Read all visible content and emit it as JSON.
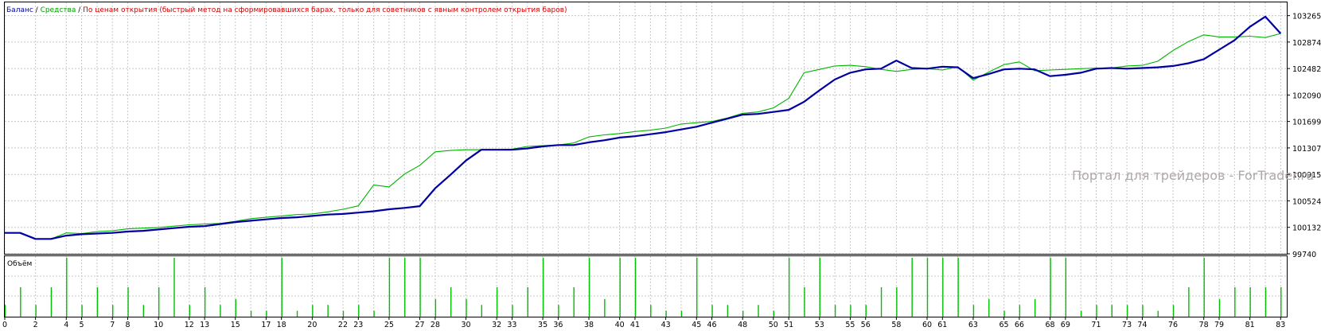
{
  "legend": {
    "balance": "Баланс",
    "sep1": " / ",
    "equity": "Средства",
    "sep2": " / ",
    "method": "По ценам открытия (быстрый метод на сформировавшихся барах, только для советников с явным контролем открытия баров)"
  },
  "watermark": "Портал для трейдеров - ForTrader.ru",
  "volume_label": "Объём",
  "colors": {
    "balance": "#0000a0",
    "equity": "#00b400",
    "volume": "#00c000",
    "grid": "#c8c8c8",
    "frame": "#000000"
  },
  "chart_data": [
    {
      "type": "line",
      "title": "",
      "ylim": [
        99740,
        103461
      ],
      "y_ticks": [
        103265,
        102874,
        102482,
        102090,
        101699,
        101307,
        100915,
        100524,
        100132,
        99740
      ],
      "x_ticks": [
        "0",
        "2",
        "4",
        "5",
        "7",
        "8",
        "10",
        "12",
        "13",
        "15",
        "17",
        "18",
        "20",
        "22",
        "23",
        "25",
        "27",
        "28",
        "30",
        "32",
        "33",
        "35",
        "36",
        "38",
        "40",
        "41",
        "43",
        "45",
        "46",
        "48",
        "50",
        "51",
        "53",
        "55",
        "56",
        "58",
        "60",
        "61",
        "63",
        "65",
        "66",
        "68",
        "69",
        "71",
        "73",
        "74",
        "76",
        "78",
        "79",
        "81",
        "83"
      ],
      "grid": true,
      "series": [
        {
          "name": "Баланс",
          "x": [
            0,
            1,
            2,
            3,
            4,
            5,
            6,
            7,
            8,
            9,
            10,
            11,
            12,
            13,
            14,
            15,
            16,
            17,
            18,
            19,
            20,
            21,
            22,
            23,
            24,
            25,
            26,
            27,
            28,
            29,
            30,
            31,
            32,
            33,
            34,
            35,
            36,
            37,
            38,
            39,
            40,
            41,
            42,
            43,
            44,
            45,
            46,
            47,
            48,
            49,
            50,
            51,
            52,
            53,
            54,
            55,
            56,
            57,
            58,
            59,
            60,
            61,
            62,
            63,
            64,
            65,
            66,
            67,
            68,
            69,
            70,
            71,
            72,
            73,
            74,
            75,
            76,
            77,
            78,
            79,
            80,
            81,
            82,
            83
          ],
          "values": [
            100050,
            100050,
            99960,
            99960,
            100010,
            100030,
            100040,
            100050,
            100070,
            100080,
            100100,
            100120,
            100140,
            100150,
            100180,
            100210,
            100230,
            100250,
            100270,
            100280,
            100300,
            100320,
            100330,
            100350,
            100370,
            100400,
            100420,
            100445,
            100710,
            100910,
            101120,
            101280,
            101280,
            101280,
            101300,
            101330,
            101350,
            101350,
            101390,
            101420,
            101460,
            101480,
            101510,
            101540,
            101580,
            101620,
            101680,
            101740,
            101800,
            101810,
            101840,
            101870,
            101990,
            102160,
            102320,
            102420,
            102470,
            102480,
            102600,
            102490,
            102480,
            102510,
            102500,
            102340,
            102400,
            102470,
            102480,
            102470,
            102370,
            102390,
            102420,
            102480,
            102490,
            102480,
            102490,
            102500,
            102520,
            102560,
            102620,
            102760,
            102900,
            103100,
            103250,
            103000
          ]
        },
        {
          "name": "Средства",
          "x": [
            0,
            1,
            2,
            3,
            4,
            5,
            6,
            7,
            8,
            9,
            10,
            11,
            12,
            13,
            14,
            15,
            16,
            17,
            18,
            19,
            20,
            21,
            22,
            23,
            24,
            25,
            26,
            27,
            28,
            29,
            30,
            31,
            32,
            33,
            34,
            35,
            36,
            37,
            38,
            39,
            40,
            41,
            42,
            43,
            44,
            45,
            46,
            47,
            48,
            49,
            50,
            51,
            52,
            53,
            54,
            55,
            56,
            57,
            58,
            59,
            60,
            61,
            62,
            63,
            64,
            65,
            66,
            67,
            68,
            69,
            70,
            71,
            72,
            73,
            74,
            75,
            76,
            77,
            78,
            79,
            80,
            81,
            82,
            83
          ],
          "values": [
            100050,
            100050,
            99960,
            99960,
            100050,
            100040,
            100070,
            100080,
            100110,
            100120,
            100130,
            100150,
            100170,
            100180,
            100190,
            100220,
            100260,
            100280,
            100300,
            100320,
            100330,
            100360,
            100400,
            100450,
            100760,
            100730,
            100920,
            101050,
            101250,
            101270,
            101280,
            101280,
            101280,
            101290,
            101330,
            101340,
            101350,
            101380,
            101470,
            101500,
            101520,
            101550,
            101570,
            101600,
            101660,
            101680,
            101700,
            101750,
            101820,
            101840,
            101900,
            102040,
            102420,
            102470,
            102520,
            102530,
            102510,
            102470,
            102440,
            102470,
            102480,
            102460,
            102510,
            102310,
            102430,
            102540,
            102580,
            102450,
            102460,
            102470,
            102480,
            102490,
            102490,
            102520,
            102530,
            102590,
            102750,
            102880,
            102980,
            102950,
            102950,
            102960,
            102940,
            103000
          ]
        }
      ]
    },
    {
      "type": "bar",
      "title": "Объём",
      "x": [
        0,
        1,
        2,
        3,
        4,
        5,
        6,
        7,
        8,
        9,
        10,
        11,
        12,
        13,
        14,
        15,
        16,
        17,
        18,
        19,
        20,
        21,
        22,
        23,
        24,
        25,
        26,
        27,
        28,
        29,
        30,
        31,
        32,
        33,
        34,
        35,
        36,
        37,
        38,
        39,
        40,
        41,
        42,
        43,
        44,
        45,
        46,
        47,
        48,
        49,
        50,
        51,
        52,
        53,
        54,
        55,
        56,
        57,
        58,
        59,
        60,
        61,
        62,
        63,
        64,
        65,
        66,
        67,
        68,
        69,
        70,
        71,
        72,
        73,
        74,
        75,
        76,
        77,
        78,
        79,
        80,
        81,
        82,
        83
      ],
      "values": [
        2,
        5,
        2,
        5,
        10,
        2,
        5,
        2,
        5,
        2,
        5,
        10,
        2,
        5,
        2,
        3,
        1,
        1,
        10,
        1,
        2,
        2,
        1,
        2,
        1,
        10,
        10,
        10,
        3,
        5,
        3,
        2,
        5,
        2,
        5,
        10,
        2,
        5,
        10,
        3,
        10,
        10,
        2,
        1,
        1,
        10,
        2,
        2,
        1,
        2,
        1,
        10,
        5,
        10,
        2,
        2,
        2,
        5,
        5,
        10,
        10,
        10,
        10,
        2,
        3,
        1,
        2,
        3,
        10,
        10,
        1,
        2,
        2,
        2,
        2,
        1,
        2,
        5,
        10,
        3,
        5,
        5,
        5,
        5
      ]
    }
  ]
}
